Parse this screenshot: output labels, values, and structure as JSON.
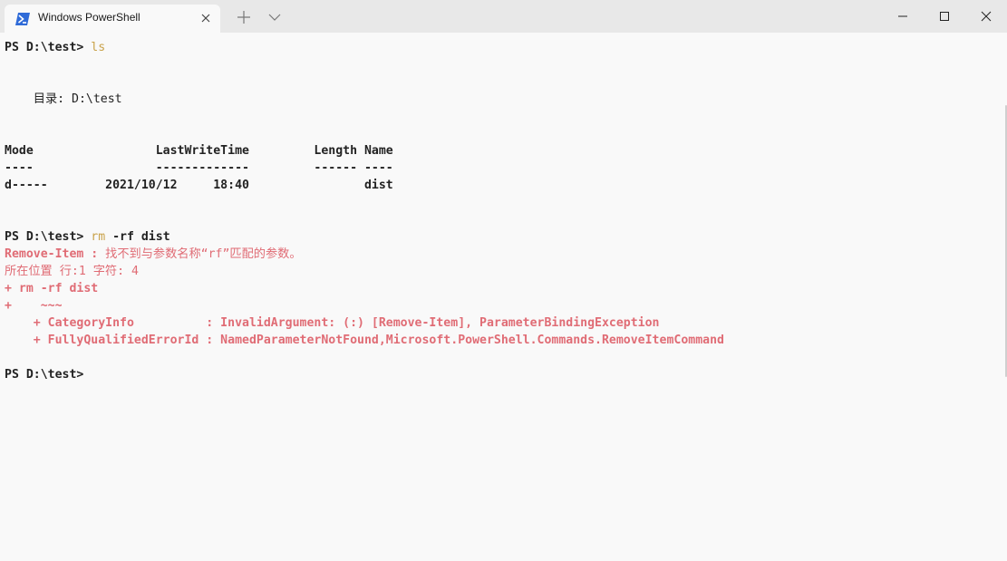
{
  "window": {
    "tab_title": "Windows PowerShell",
    "tab_icon": "powershell-icon",
    "colors": {
      "titlebar": "#e8e8e8",
      "background": "#f9f9f9",
      "command": "#c9a24a",
      "error": "#e06c75",
      "text": "#222222"
    }
  },
  "terminal": {
    "lines": [
      {
        "prompt": "PS D:\\test> ",
        "command": "ls"
      },
      {
        "text": "    目录: D:\\test"
      },
      {
        "text": "Mode                 LastWriteTime         Length Name"
      },
      {
        "text": "----                 -------------         ------ ----"
      },
      {
        "text": "d-----        2021/10/12     18:40                dist"
      },
      {
        "prompt": "PS D:\\test> ",
        "command": "rm",
        "args": " -rf dist"
      },
      {
        "error_prefix": "Remove-Item : ",
        "error_cjk": "找不到与参数名称“rf”匹配的参数。"
      },
      {
        "error_cjk": "所在位置 行:1 字符: 4"
      },
      {
        "error": "+ rm -rf dist"
      },
      {
        "error": "+    ~~~"
      },
      {
        "error": "    + CategoryInfo          : InvalidArgument: (:) [Remove-Item], ParameterBindingException"
      },
      {
        "error": "    + FullyQualifiedErrorId : NamedParameterNotFound,Microsoft.PowerShell.Commands.RemoveItemCommand"
      },
      {
        "prompt": "PS D:\\test> "
      }
    ]
  }
}
